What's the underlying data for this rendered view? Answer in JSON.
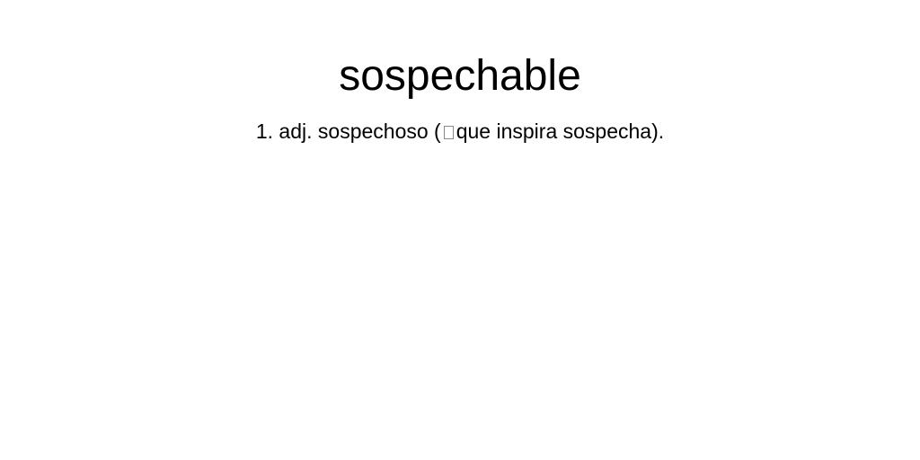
{
  "entry": {
    "headword": "sospechable",
    "definition": {
      "number": "1.",
      "category": "adj.",
      "synonym": "sospechoso",
      "open_paren": "(",
      "gloss": "que inspira sospecha",
      "close": ")."
    }
  }
}
